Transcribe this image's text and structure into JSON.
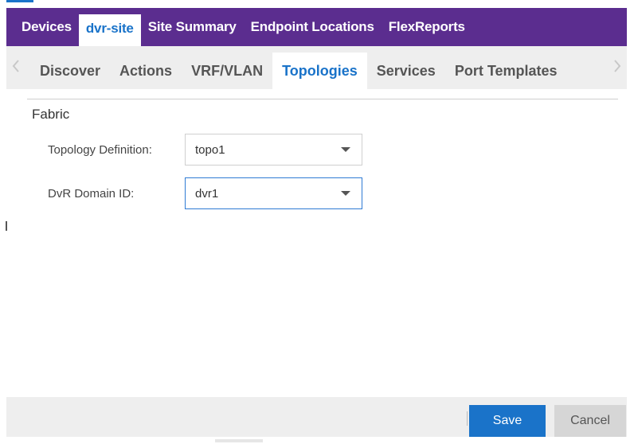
{
  "main_tabs": [
    {
      "label": "Devices",
      "active": false
    },
    {
      "label": "dvr-site",
      "active": true
    },
    {
      "label": "Site Summary",
      "active": false
    },
    {
      "label": "Endpoint Locations",
      "active": false
    },
    {
      "label": "FlexReports",
      "active": false
    }
  ],
  "sub_tabs": [
    {
      "label": "Discover",
      "active": false
    },
    {
      "label": "Actions",
      "active": false
    },
    {
      "label": "VRF/VLAN",
      "active": false
    },
    {
      "label": "Topologies",
      "active": true
    },
    {
      "label": "Services",
      "active": false
    },
    {
      "label": "Port Templates",
      "active": false
    }
  ],
  "section": {
    "title": "Fabric"
  },
  "form": {
    "topology_definition": {
      "label": "Topology Definition:",
      "value": "topo1"
    },
    "dvr_domain_id": {
      "label": "DvR Domain ID:",
      "value": "dvr1"
    }
  },
  "footer": {
    "save_label": "Save",
    "cancel_label": "Cancel"
  },
  "colors": {
    "header_purple": "#5b2d8f",
    "active_blue": "#1a73c9",
    "tab_bg": "#eeeeee"
  },
  "icons": {
    "scroll_left": "chevron-left-icon",
    "scroll_right": "chevron-right-icon",
    "dropdown": "caret-down-icon"
  }
}
